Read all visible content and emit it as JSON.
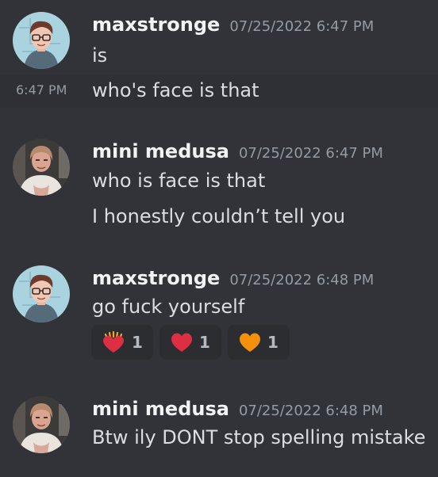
{
  "messages": [
    {
      "author": "maxstronge",
      "timestamp": "07/25/2022 6:47 PM",
      "lines": [
        "is"
      ],
      "avatar_icon": "maxstronge-avatar"
    },
    {
      "hover_time": "6:47 PM",
      "text": "who's face is that"
    },
    {
      "author": "mini medusa",
      "timestamp": "07/25/2022 6:47 PM",
      "lines": [
        "who is face is that",
        "I honestly couldn’t tell you"
      ],
      "avatar_icon": "mini-medusa-avatar"
    },
    {
      "author": "maxstronge",
      "timestamp": "07/25/2022 6:48 PM",
      "lines": [
        "go fuck yourself"
      ],
      "avatar_icon": "maxstronge-avatar"
    },
    {
      "author": "mini medusa",
      "timestamp": "07/25/2022 6:48 PM",
      "lines": [
        "Btw ily DONT stop spelling mistake"
      ],
      "avatar_icon": "mini-medusa-avatar"
    }
  ],
  "reactions": [
    {
      "emoji": "heart-on-fire",
      "count": "1"
    },
    {
      "emoji": "red-heart",
      "count": "1"
    },
    {
      "emoji": "orange-heart",
      "count": "1"
    }
  ],
  "colors": {
    "background": "#313338",
    "hover_row": "#2e3035",
    "username": "#f2f3f5",
    "timestamp": "#949ba4",
    "text": "#dbdee1",
    "reaction_bg": "#2b2d31"
  }
}
